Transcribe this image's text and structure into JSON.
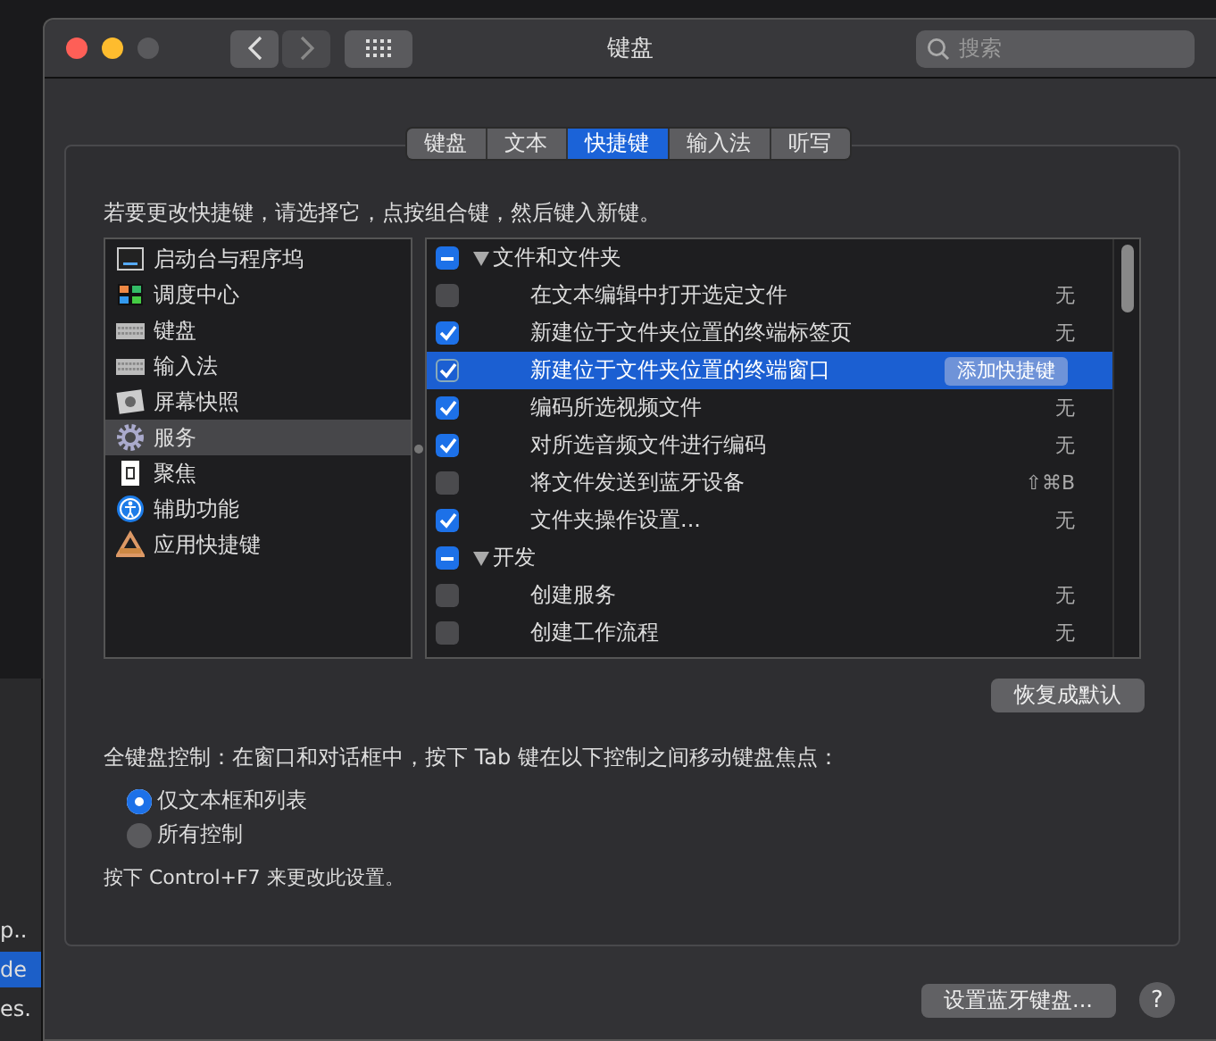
{
  "background_window": {
    "fragments": [
      "p..",
      "de",
      "es."
    ]
  },
  "window": {
    "title": "键盘"
  },
  "search": {
    "placeholder": "搜索"
  },
  "tabs": [
    {
      "label": "键盘",
      "selected": false
    },
    {
      "label": "文本",
      "selected": false
    },
    {
      "label": "快捷键",
      "selected": true
    },
    {
      "label": "输入法",
      "selected": false
    },
    {
      "label": "听写",
      "selected": false
    }
  ],
  "instruction": "若要更改快捷键，请选择它，点按组合键，然后键入新键。",
  "categories": [
    {
      "label": "启动台与程序坞",
      "selected": false
    },
    {
      "label": "调度中心",
      "selected": false
    },
    {
      "label": "键盘",
      "selected": false
    },
    {
      "label": "输入法",
      "selected": false
    },
    {
      "label": "屏幕快照",
      "selected": false
    },
    {
      "label": "服务",
      "selected": true
    },
    {
      "label": "聚焦",
      "selected": false
    },
    {
      "label": "辅助功能",
      "selected": false
    },
    {
      "label": "应用快捷键",
      "selected": false
    }
  ],
  "shortcut_groups": [
    {
      "label": "文件和文件夹",
      "checked": true,
      "partial": true,
      "expanded": true,
      "children": [
        {
          "label": "在文本编辑中打开选定文件",
          "checked": false,
          "selected": false,
          "shortcut": "无"
        },
        {
          "label": "新建位于文件夹位置的终端标签页",
          "checked": true,
          "selected": false,
          "shortcut": "无"
        },
        {
          "label": "新建位于文件夹位置的终端窗口",
          "checked": true,
          "selected": true,
          "add_button": "添加快捷键"
        },
        {
          "label": "编码所选视频文件",
          "checked": true,
          "selected": false,
          "shortcut": "无"
        },
        {
          "label": "对所选音频文件进行编码",
          "checked": true,
          "selected": false,
          "shortcut": "无"
        },
        {
          "label": "将文件发送到蓝牙设备",
          "checked": false,
          "selected": false,
          "shortcut": "⇧⌘B"
        },
        {
          "label": "文件夹操作设置...",
          "checked": true,
          "selected": false,
          "shortcut": "无"
        }
      ]
    },
    {
      "label": "开发",
      "checked": true,
      "partial": true,
      "expanded": true,
      "children": [
        {
          "label": "创建服务",
          "checked": false,
          "selected": false,
          "shortcut": "无"
        },
        {
          "label": "创建工作流程",
          "checked": false,
          "selected": false,
          "shortcut": "无"
        }
      ]
    }
  ],
  "restore_button": "恢复成默认",
  "full_keyboard_access": {
    "label": "全键盘控制：在窗口和对话框中，按下 Tab 键在以下控制之间移动键盘焦点：",
    "options": [
      {
        "label": "仅文本框和列表",
        "selected": true
      },
      {
        "label": "所有控制",
        "selected": false
      }
    ],
    "note": "按下 Control+F7 来更改此设置。"
  },
  "bluetooth_button": "设置蓝牙键盘...",
  "help_button": "?"
}
